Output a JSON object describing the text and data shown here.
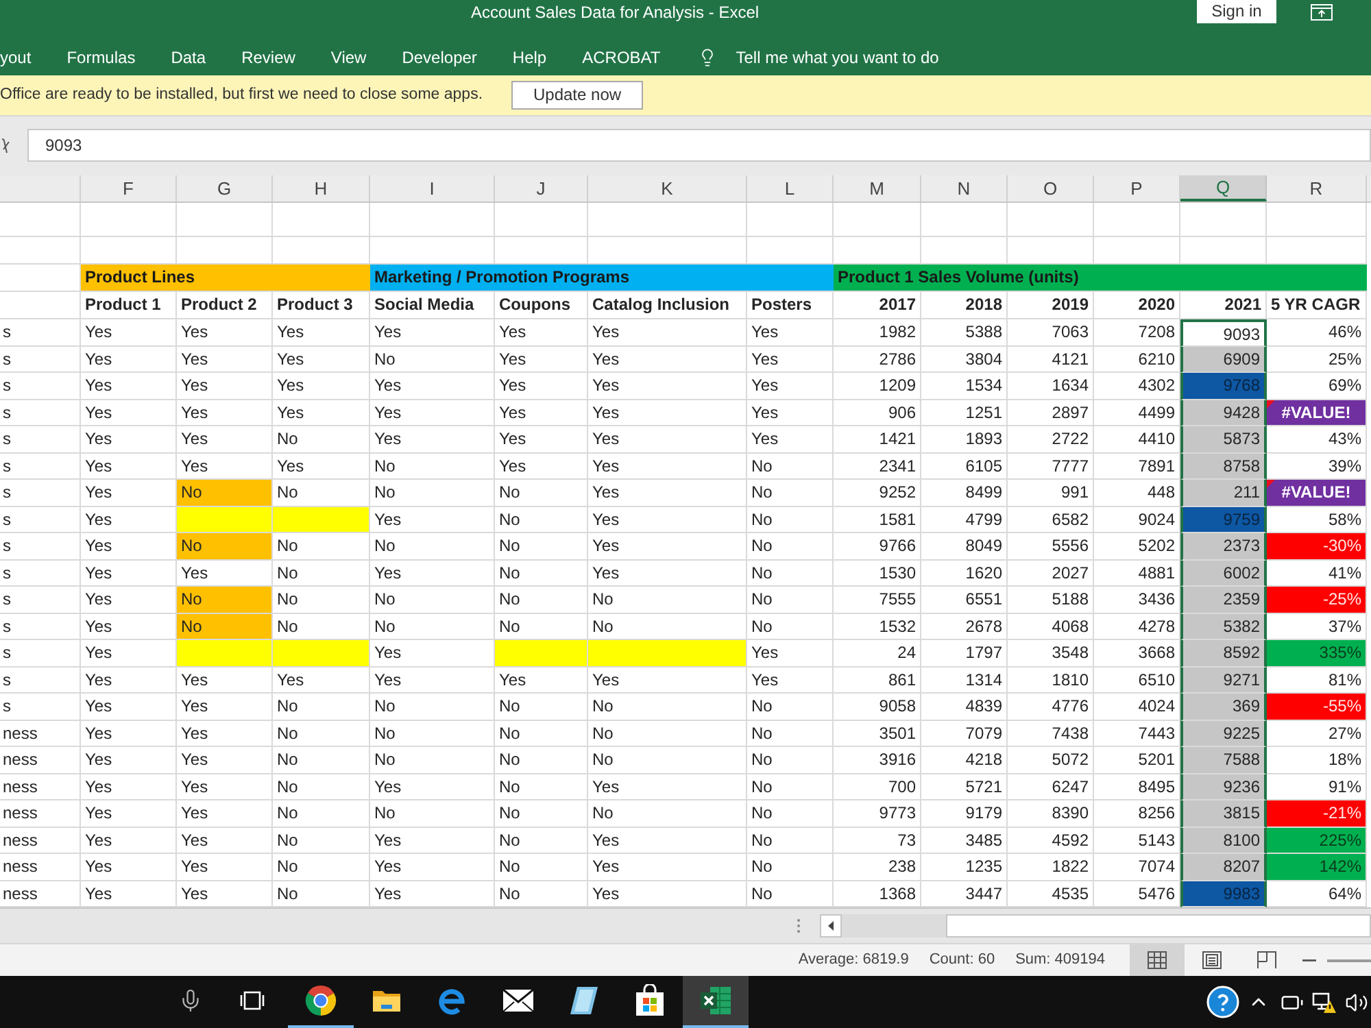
{
  "window": {
    "title": "Account Sales Data for Analysis - Excel",
    "sign_in": "Sign in"
  },
  "ribbon": {
    "tabs": [
      "yout",
      "Formulas",
      "Data",
      "Review",
      "View",
      "Developer",
      "Help",
      "ACROBAT"
    ],
    "tell_me": "Tell me what you want to do"
  },
  "message_bar": {
    "text": "Office are ready to be installed, but first we need to close some apps.",
    "button": "Update now"
  },
  "formula_bar": {
    "value": "9093"
  },
  "columns": [
    {
      "letter": "F",
      "selected": false
    },
    {
      "letter": "G",
      "selected": false
    },
    {
      "letter": "H",
      "selected": false
    },
    {
      "letter": "I",
      "selected": false
    },
    {
      "letter": "J",
      "selected": false
    },
    {
      "letter": "K",
      "selected": false
    },
    {
      "letter": "L",
      "selected": false
    },
    {
      "letter": "M",
      "selected": false
    },
    {
      "letter": "N",
      "selected": false
    },
    {
      "letter": "O",
      "selected": false
    },
    {
      "letter": "P",
      "selected": false
    },
    {
      "letter": "Q",
      "selected": true
    },
    {
      "letter": "R",
      "selected": false
    }
  ],
  "groups": [
    {
      "label": "Product Lines",
      "color": "#ffc000"
    },
    {
      "label": "Marketing / Promotion Programs",
      "color": "#00b0f0"
    },
    {
      "label": "Product 1 Sales Volume (units)",
      "color": "#00b050"
    }
  ],
  "headers": [
    "Product 1",
    "Product 2",
    "Product 3",
    "Social Media",
    "Coupons",
    "Catalog Inclusion",
    "Posters",
    "2017",
    "2018",
    "2019",
    "2020",
    "2021",
    "5 YR CAGR"
  ],
  "rows": [
    {
      "label": "s",
      "flags": [
        {
          "text": "Yes"
        },
        {
          "text": "Yes"
        },
        {
          "text": "Yes"
        },
        {
          "text": "Yes"
        },
        {
          "text": "Yes"
        },
        {
          "text": "Yes"
        },
        {
          "text": "Yes"
        }
      ],
      "volumes": [
        "1982",
        "5388",
        "7063",
        "7208"
      ],
      "latest": {
        "text": "9093",
        "selected": true,
        "active": true
      },
      "cagr": {
        "text": "46%",
        "kind": "plain"
      }
    },
    {
      "label": "s",
      "flags": [
        {
          "text": "Yes"
        },
        {
          "text": "Yes"
        },
        {
          "text": "Yes"
        },
        {
          "text": "No"
        },
        {
          "text": "Yes"
        },
        {
          "text": "Yes"
        },
        {
          "text": "Yes"
        }
      ],
      "volumes": [
        "2786",
        "3804",
        "4121",
        "6210"
      ],
      "latest": {
        "text": "6909",
        "selected": true,
        "active": false
      },
      "cagr": {
        "text": "25%",
        "kind": "plain"
      }
    },
    {
      "label": "s",
      "flags": [
        {
          "text": "Yes"
        },
        {
          "text": "Yes"
        },
        {
          "text": "Yes"
        },
        {
          "text": "Yes"
        },
        {
          "text": "Yes"
        },
        {
          "text": "Yes"
        },
        {
          "text": "Yes"
        }
      ],
      "volumes": [
        "1209",
        "1534",
        "1634",
        "4302"
      ],
      "latest": {
        "text": "9768",
        "selected": true,
        "active": false,
        "color": "#0d57a3"
      },
      "cagr": {
        "text": "69%",
        "kind": "plain"
      }
    },
    {
      "label": "s",
      "flags": [
        {
          "text": "Yes"
        },
        {
          "text": "Yes"
        },
        {
          "text": "Yes"
        },
        {
          "text": "Yes"
        },
        {
          "text": "Yes"
        },
        {
          "text": "Yes"
        },
        {
          "text": "Yes"
        }
      ],
      "volumes": [
        "906",
        "1251",
        "2897",
        "4499"
      ],
      "latest": {
        "text": "9428",
        "selected": true,
        "active": false
      },
      "cagr": {
        "text": "#VALUE!",
        "kind": "error",
        "color": "#7030a0"
      }
    },
    {
      "label": "s",
      "flags": [
        {
          "text": "Yes"
        },
        {
          "text": "Yes"
        },
        {
          "text": "No"
        },
        {
          "text": "Yes"
        },
        {
          "text": "Yes"
        },
        {
          "text": "Yes"
        },
        {
          "text": "Yes"
        }
      ],
      "volumes": [
        "1421",
        "1893",
        "2722",
        "4410"
      ],
      "latest": {
        "text": "5873",
        "selected": true,
        "active": false
      },
      "cagr": {
        "text": "43%",
        "kind": "plain"
      }
    },
    {
      "label": "s",
      "flags": [
        {
          "text": "Yes"
        },
        {
          "text": "Yes"
        },
        {
          "text": "Yes"
        },
        {
          "text": "No"
        },
        {
          "text": "Yes"
        },
        {
          "text": "Yes"
        },
        {
          "text": "No"
        }
      ],
      "volumes": [
        "2341",
        "6105",
        "7777",
        "7891"
      ],
      "latest": {
        "text": "8758",
        "selected": true,
        "active": false
      },
      "cagr": {
        "text": "39%",
        "kind": "plain"
      }
    },
    {
      "label": "s",
      "flags": [
        {
          "text": "Yes"
        },
        {
          "text": "No",
          "color": "#ffc000"
        },
        {
          "text": "No"
        },
        {
          "text": "No"
        },
        {
          "text": "No"
        },
        {
          "text": "Yes"
        },
        {
          "text": "No"
        }
      ],
      "volumes": [
        "9252",
        "8499",
        "991",
        "448"
      ],
      "latest": {
        "text": "211",
        "selected": true,
        "active": false
      },
      "cagr": {
        "text": "#VALUE!",
        "kind": "error",
        "color": "#7030a0"
      }
    },
    {
      "label": "s",
      "flags": [
        {
          "text": "Yes"
        },
        {
          "color": "#ffff00"
        },
        {
          "color": "#ffff00"
        },
        {
          "text": "Yes"
        },
        {
          "text": "No"
        },
        {
          "text": "Yes"
        },
        {
          "text": "No"
        }
      ],
      "volumes": [
        "1581",
        "4799",
        "6582",
        "9024"
      ],
      "latest": {
        "text": "9759",
        "selected": true,
        "active": false,
        "color": "#0d57a3"
      },
      "cagr": {
        "text": "58%",
        "kind": "plain"
      }
    },
    {
      "label": "s",
      "flags": [
        {
          "text": "Yes"
        },
        {
          "text": "No",
          "color": "#ffc000"
        },
        {
          "text": "No"
        },
        {
          "text": "No"
        },
        {
          "text": "No"
        },
        {
          "text": "Yes"
        },
        {
          "text": "No"
        }
      ],
      "volumes": [
        "9766",
        "8049",
        "5556",
        "5202"
      ],
      "latest": {
        "text": "2373",
        "selected": true,
        "active": false
      },
      "cagr": {
        "text": "-30%",
        "kind": "negative",
        "color": "#ff0000"
      }
    },
    {
      "label": "s",
      "flags": [
        {
          "text": "Yes"
        },
        {
          "text": "Yes"
        },
        {
          "text": "No"
        },
        {
          "text": "Yes"
        },
        {
          "text": "No"
        },
        {
          "text": "Yes"
        },
        {
          "text": "No"
        }
      ],
      "volumes": [
        "1530",
        "1620",
        "2027",
        "4881"
      ],
      "latest": {
        "text": "6002",
        "selected": true,
        "active": false
      },
      "cagr": {
        "text": "41%",
        "kind": "plain"
      }
    },
    {
      "label": "s",
      "flags": [
        {
          "text": "Yes"
        },
        {
          "text": "No",
          "color": "#ffc000"
        },
        {
          "text": "No"
        },
        {
          "text": "No"
        },
        {
          "text": "No"
        },
        {
          "text": "No"
        },
        {
          "text": "No"
        }
      ],
      "volumes": [
        "7555",
        "6551",
        "5188",
        "3436"
      ],
      "latest": {
        "text": "2359",
        "selected": true,
        "active": false
      },
      "cagr": {
        "text": "-25%",
        "kind": "negative",
        "color": "#ff0000"
      }
    },
    {
      "label": "s",
      "flags": [
        {
          "text": "Yes"
        },
        {
          "text": "No",
          "color": "#ffc000"
        },
        {
          "text": "No"
        },
        {
          "text": "No"
        },
        {
          "text": "No"
        },
        {
          "text": "No"
        },
        {
          "text": "No"
        }
      ],
      "volumes": [
        "1532",
        "2678",
        "4068",
        "4278"
      ],
      "latest": {
        "text": "5382",
        "selected": true,
        "active": false
      },
      "cagr": {
        "text": "37%",
        "kind": "plain"
      }
    },
    {
      "label": "s",
      "flags": [
        {
          "text": "Yes"
        },
        {
          "color": "#ffff00"
        },
        {
          "color": "#ffff00"
        },
        {
          "text": "Yes"
        },
        {
          "color": "#ffff00"
        },
        {
          "color": "#ffff00"
        },
        {
          "text": "Yes"
        }
      ],
      "volumes": [
        "24",
        "1797",
        "3548",
        "3668"
      ],
      "latest": {
        "text": "8592",
        "selected": true,
        "active": false
      },
      "cagr": {
        "text": "335%",
        "kind": "positive",
        "color": "#00b050"
      }
    },
    {
      "label": "s",
      "flags": [
        {
          "text": "Yes"
        },
        {
          "text": "Yes"
        },
        {
          "text": "Yes"
        },
        {
          "text": "Yes"
        },
        {
          "text": "Yes"
        },
        {
          "text": "Yes"
        },
        {
          "text": "Yes"
        }
      ],
      "volumes": [
        "861",
        "1314",
        "1810",
        "6510"
      ],
      "latest": {
        "text": "9271",
        "selected": true,
        "active": false
      },
      "cagr": {
        "text": "81%",
        "kind": "plain"
      }
    },
    {
      "label": "s",
      "flags": [
        {
          "text": "Yes"
        },
        {
          "text": "Yes"
        },
        {
          "text": "No"
        },
        {
          "text": "No"
        },
        {
          "text": "No"
        },
        {
          "text": "No"
        },
        {
          "text": "No"
        }
      ],
      "volumes": [
        "9058",
        "4839",
        "4776",
        "4024"
      ],
      "latest": {
        "text": "369",
        "selected": true,
        "active": false
      },
      "cagr": {
        "text": "-55%",
        "kind": "negative",
        "color": "#ff0000"
      }
    },
    {
      "label": "ness",
      "flags": [
        {
          "text": "Yes"
        },
        {
          "text": "Yes"
        },
        {
          "text": "No"
        },
        {
          "text": "No"
        },
        {
          "text": "No"
        },
        {
          "text": "No"
        },
        {
          "text": "No"
        }
      ],
      "volumes": [
        "3501",
        "7079",
        "7438",
        "7443"
      ],
      "latest": {
        "text": "9225",
        "selected": true,
        "active": false
      },
      "cagr": {
        "text": "27%",
        "kind": "plain"
      }
    },
    {
      "label": "ness",
      "flags": [
        {
          "text": "Yes"
        },
        {
          "text": "Yes"
        },
        {
          "text": "No"
        },
        {
          "text": "No"
        },
        {
          "text": "No"
        },
        {
          "text": "No"
        },
        {
          "text": "No"
        }
      ],
      "volumes": [
        "3916",
        "4218",
        "5072",
        "5201"
      ],
      "latest": {
        "text": "7588",
        "selected": true,
        "active": false
      },
      "cagr": {
        "text": "18%",
        "kind": "plain"
      }
    },
    {
      "label": "ness",
      "flags": [
        {
          "text": "Yes"
        },
        {
          "text": "Yes"
        },
        {
          "text": "No"
        },
        {
          "text": "Yes"
        },
        {
          "text": "No"
        },
        {
          "text": "Yes"
        },
        {
          "text": "No"
        }
      ],
      "volumes": [
        "700",
        "5721",
        "6247",
        "8495"
      ],
      "latest": {
        "text": "9236",
        "selected": true,
        "active": false
      },
      "cagr": {
        "text": "91%",
        "kind": "plain"
      }
    },
    {
      "label": "ness",
      "flags": [
        {
          "text": "Yes"
        },
        {
          "text": "Yes"
        },
        {
          "text": "No"
        },
        {
          "text": "No"
        },
        {
          "text": "No"
        },
        {
          "text": "No"
        },
        {
          "text": "No"
        }
      ],
      "volumes": [
        "9773",
        "9179",
        "8390",
        "8256"
      ],
      "latest": {
        "text": "3815",
        "selected": true,
        "active": false
      },
      "cagr": {
        "text": "-21%",
        "kind": "negative",
        "color": "#ff0000"
      }
    },
    {
      "label": "ness",
      "flags": [
        {
          "text": "Yes"
        },
        {
          "text": "Yes"
        },
        {
          "text": "No"
        },
        {
          "text": "Yes"
        },
        {
          "text": "No"
        },
        {
          "text": "Yes"
        },
        {
          "text": "No"
        }
      ],
      "volumes": [
        "73",
        "3485",
        "4592",
        "5143"
      ],
      "latest": {
        "text": "8100",
        "selected": true,
        "active": false
      },
      "cagr": {
        "text": "225%",
        "kind": "positive",
        "color": "#00b050"
      }
    },
    {
      "label": "ness",
      "flags": [
        {
          "text": "Yes"
        },
        {
          "text": "Yes"
        },
        {
          "text": "No"
        },
        {
          "text": "Yes"
        },
        {
          "text": "No"
        },
        {
          "text": "Yes"
        },
        {
          "text": "No"
        }
      ],
      "volumes": [
        "238",
        "1235",
        "1822",
        "7074"
      ],
      "latest": {
        "text": "8207",
        "selected": true,
        "active": false
      },
      "cagr": {
        "text": "142%",
        "kind": "positive",
        "color": "#00b050"
      }
    },
    {
      "label": "ness",
      "flags": [
        {
          "text": "Yes"
        },
        {
          "text": "Yes"
        },
        {
          "text": "No"
        },
        {
          "text": "Yes"
        },
        {
          "text": "No"
        },
        {
          "text": "Yes"
        },
        {
          "text": "No"
        }
      ],
      "volumes": [
        "1368",
        "3447",
        "4535",
        "5476"
      ],
      "latest": {
        "text": "9983",
        "selected": true,
        "active": false,
        "color": "#0d57a3"
      },
      "cagr": {
        "text": "64%",
        "kind": "plain"
      }
    }
  ],
  "status_bar": {
    "stats": [
      "Average: 6819.9",
      "Count: 60",
      "Sum: 409194"
    ],
    "views": [
      {
        "kind": "normal",
        "selected": true
      },
      {
        "kind": "page_layout",
        "selected": false
      },
      {
        "kind": "page_break",
        "selected": false
      }
    ]
  },
  "taskbar": {
    "apps": [
      {
        "kind": "microphone",
        "running": false,
        "selected": false
      },
      {
        "kind": "task_view",
        "running": false,
        "selected": false
      },
      {
        "kind": "browser",
        "running": true,
        "selected": false
      },
      {
        "kind": "folder",
        "running": false,
        "selected": false
      },
      {
        "kind": "edge",
        "running": false,
        "selected": false
      },
      {
        "kind": "mail",
        "running": false,
        "selected": false
      },
      {
        "kind": "tablet",
        "running": false,
        "selected": false
      },
      {
        "kind": "store",
        "running": false,
        "selected": false
      },
      {
        "kind": "spreadsheet",
        "running": true,
        "selected": true
      }
    ],
    "tray": [
      {
        "kind": "help"
      },
      {
        "kind": "chevron"
      },
      {
        "kind": "battery"
      },
      {
        "kind": "network_warning"
      },
      {
        "kind": "volume"
      }
    ]
  }
}
